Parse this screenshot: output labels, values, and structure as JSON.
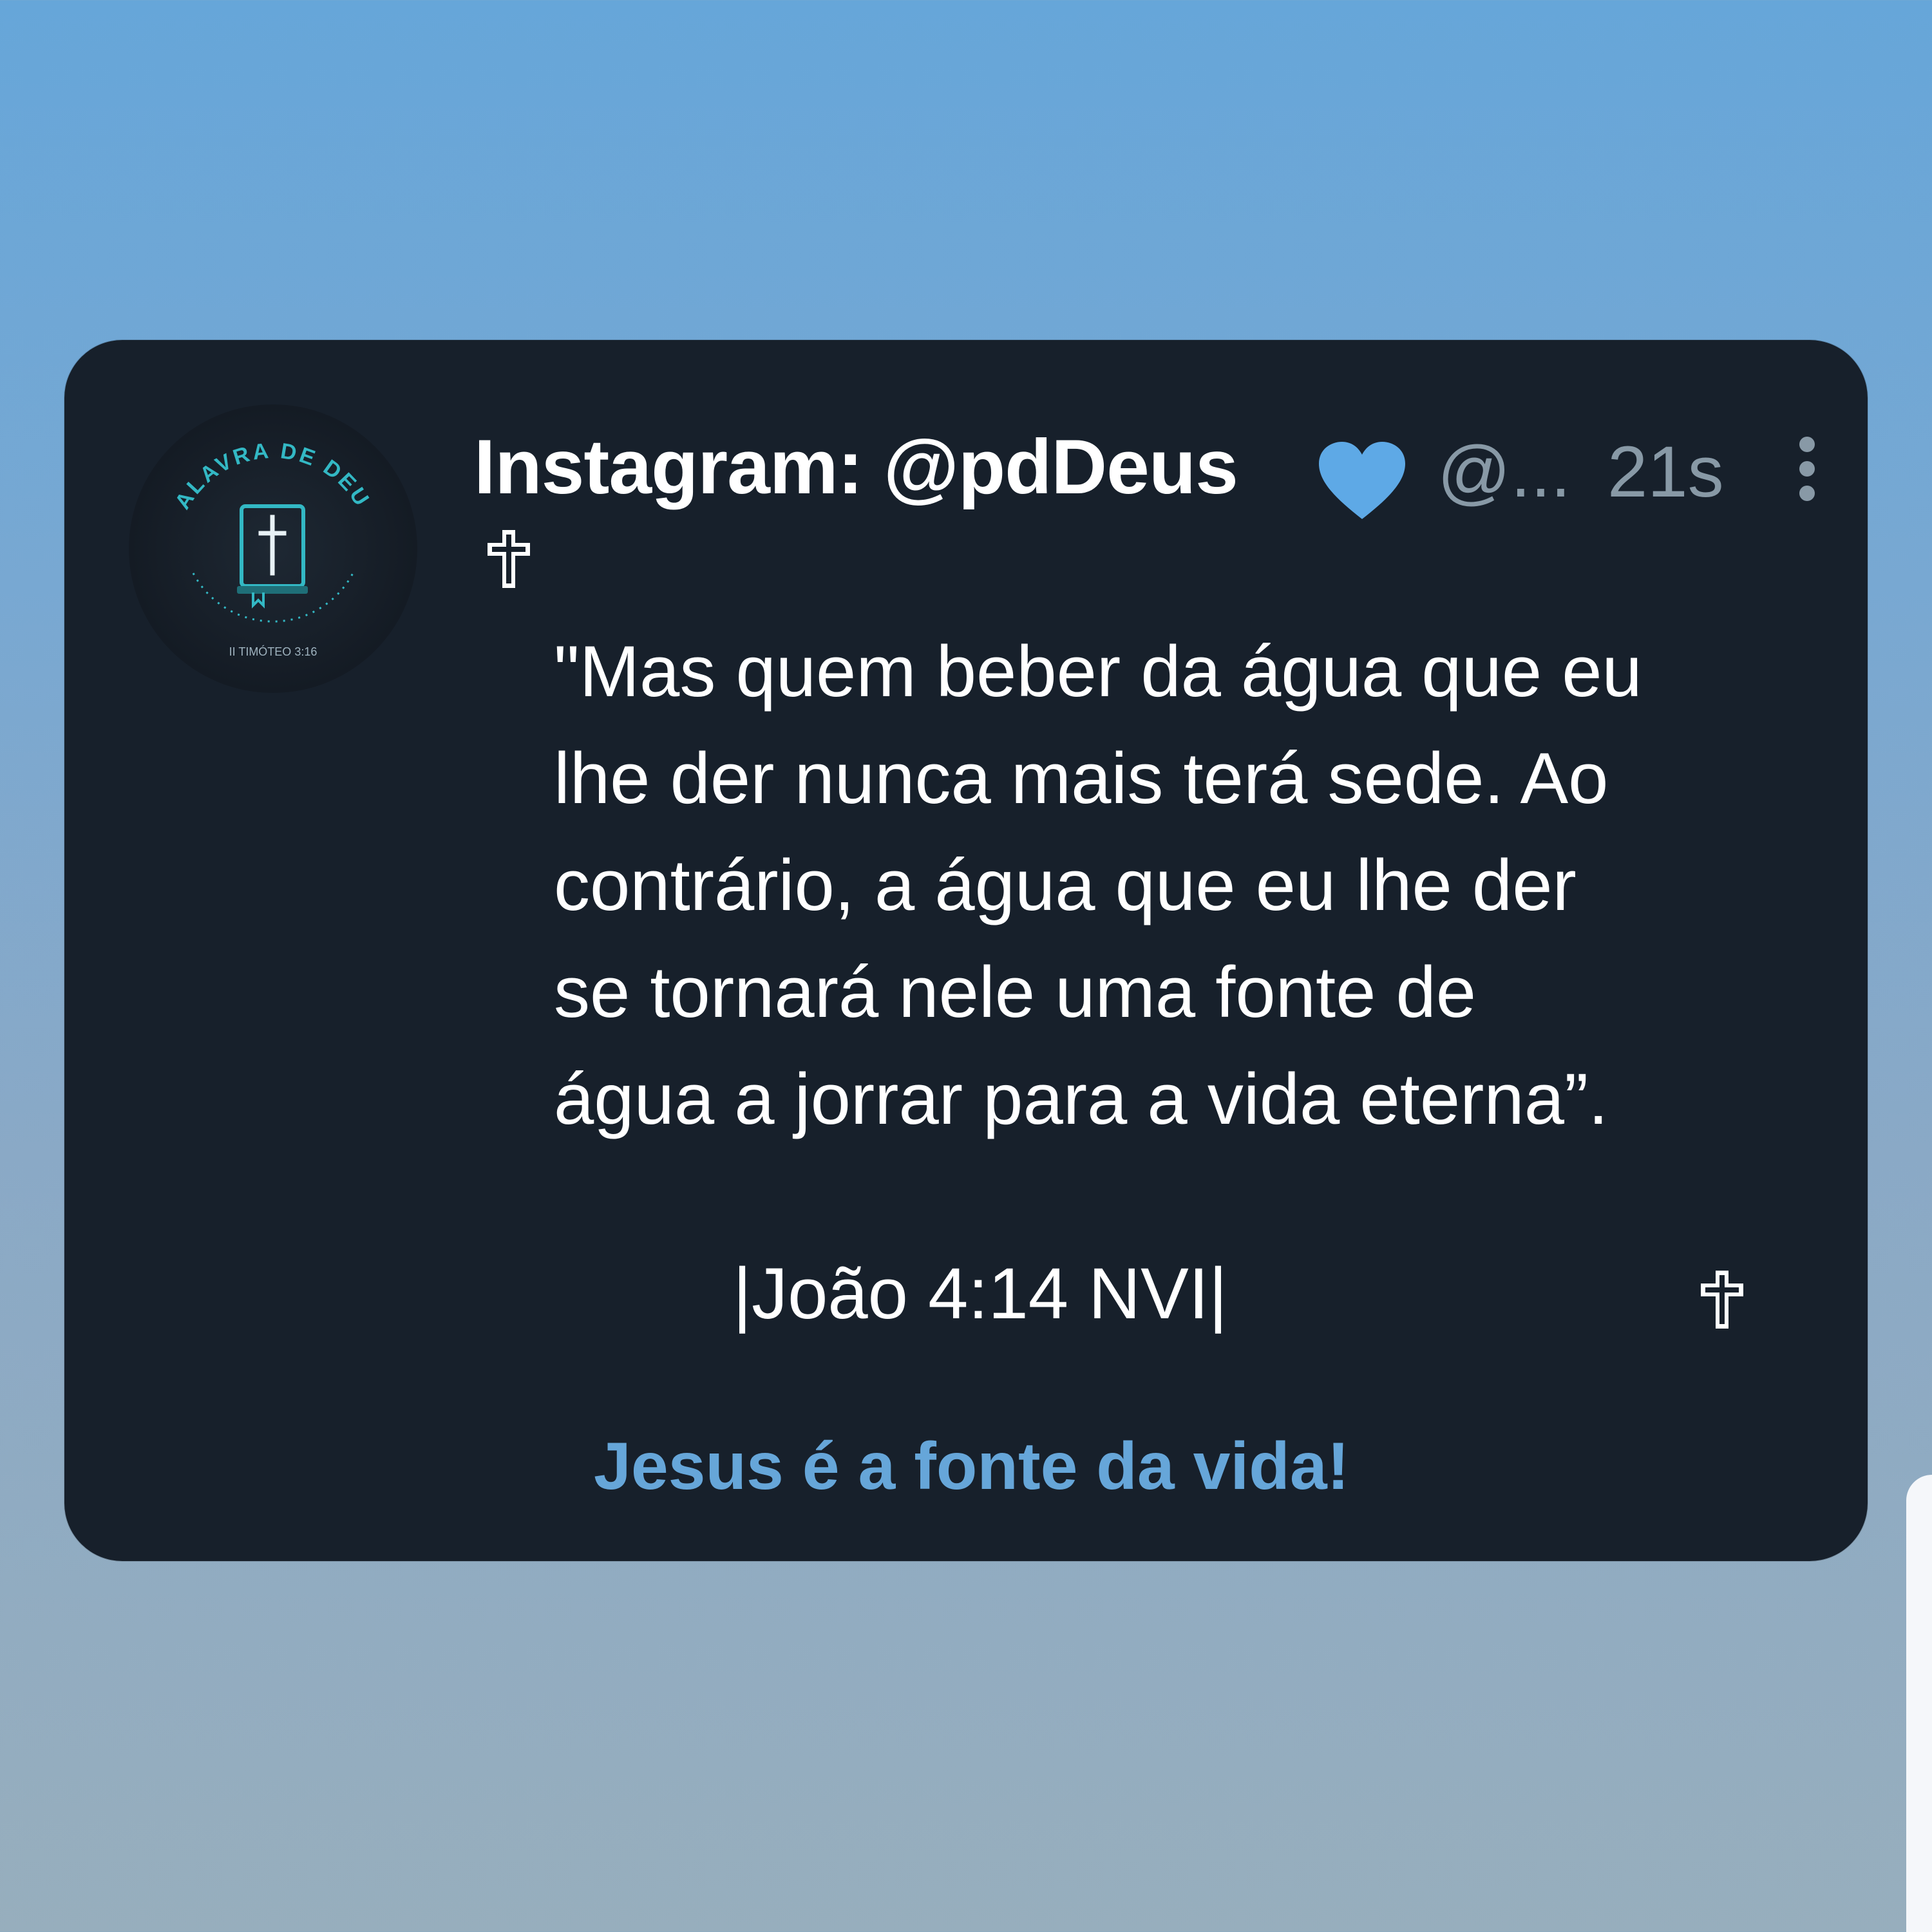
{
  "tweet": {
    "author_name": "Instagram: @pdDeus",
    "verified_heart_icon": "heart-icon",
    "handle": "@...",
    "time": "21s",
    "more_icon": "more-vertical-icon",
    "cross_icon": "latin-cross-icon",
    "verse_lines": [
      "\"Mas quem beber da água que eu",
      "lhe der nunca mais terá sede. Ao",
      "contrário, a água que eu lhe der",
      "se tornará nele uma fonte de",
      "água a jorrar para a vida eterna”."
    ],
    "reference": "|João 4:14 NVI|",
    "link_text": "Jesus é a fonte da vida!"
  },
  "avatar": {
    "arc_text": "PALAVRA DE DEUS",
    "bottom_text": "II TIMÓTEO 3:16"
  },
  "colors": {
    "card_background": "#17202b",
    "accent_blue": "#66a6d9",
    "muted_gray": "#8899a6",
    "avatar_teal": "#33b8c4"
  }
}
